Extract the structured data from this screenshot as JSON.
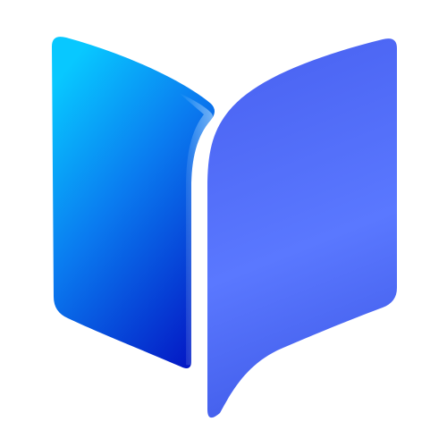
{
  "logo": {
    "icon": "open-book-icon",
    "colors": {
      "background": "#ffffff",
      "left_page_top": "#08c8ff",
      "left_page_mid": "#0a7cf0",
      "left_page_bottom": "#0417c4",
      "right_page_top": "#4a63f2",
      "right_page_mid": "#5a78ff",
      "right_page_bottom": "#3f5ae8",
      "edge_highlight": "#c9e9ff"
    }
  }
}
